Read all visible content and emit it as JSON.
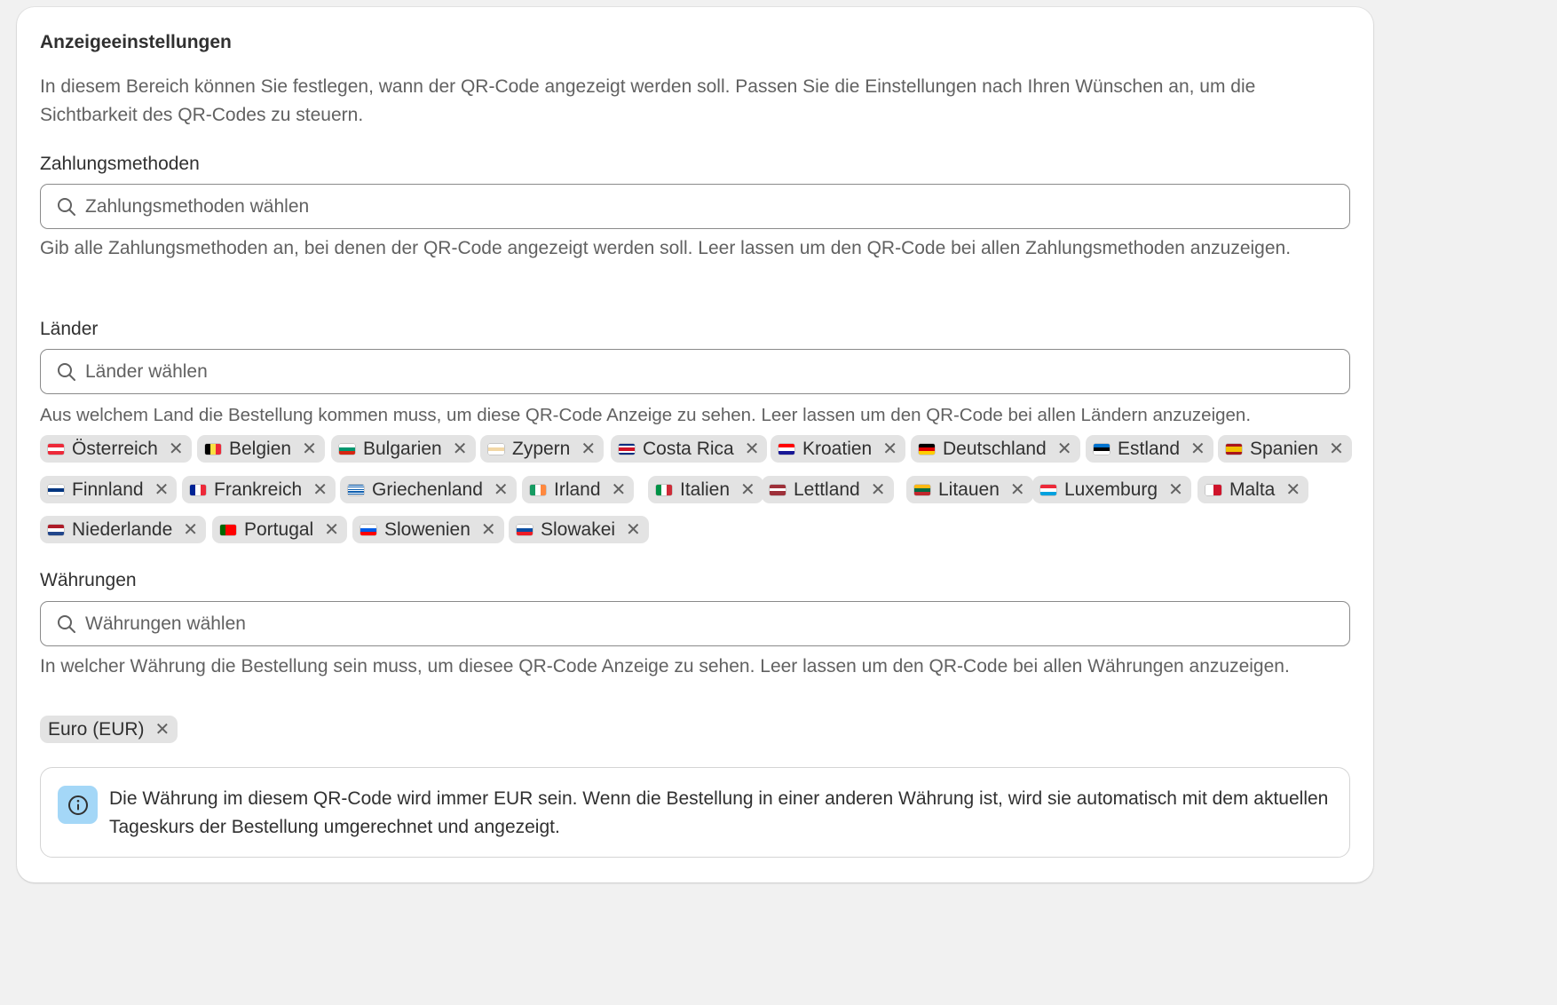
{
  "section": {
    "title": "Anzeigeeinstellungen",
    "description": "In diesem Bereich können Sie festlegen, wann der QR-Code angezeigt werden soll. Passen Sie die Einstellungen nach Ihren Wünschen an, um die Sichtbarkeit des QR-Codes zu steuern."
  },
  "payment": {
    "label": "Zahlungsmethoden",
    "placeholder": "Zahlungsmethoden wählen",
    "help": "Gib alle Zahlungsmethoden an, bei denen der QR-Code angezeigt werden soll. Leer lassen um den QR-Code bei allen Zahlungsmethoden anzuzeigen."
  },
  "countries": {
    "label": "Länder",
    "placeholder": "Länder wählen",
    "help": "Aus welchem Land die Bestellung kommen muss, um diese QR-Code Anzeige zu sehen. Leer lassen um den QR-Code bei allen Ländern anzuzeigen.",
    "tags": [
      {
        "label": "Österreich",
        "flag": "at"
      },
      {
        "label": "Belgien",
        "flag": "be"
      },
      {
        "label": "Bulgarien",
        "flag": "bg"
      },
      {
        "label": "Zypern",
        "flag": "cy"
      },
      {
        "label": "Costa Rica",
        "flag": "cr"
      },
      {
        "label": "Kroatien",
        "flag": "hr"
      },
      {
        "label": "Deutschland",
        "flag": "de"
      },
      {
        "label": "Estland",
        "flag": "ee"
      },
      {
        "label": "Spanien",
        "flag": "es"
      },
      {
        "label": "Finnland",
        "flag": "fi"
      },
      {
        "label": "Frankreich",
        "flag": "fr"
      },
      {
        "label": "Griechenland",
        "flag": "gr"
      },
      {
        "label": "Irland",
        "flag": "ie"
      },
      {
        "label": "Italien",
        "flag": "it"
      },
      {
        "label": "Lettland",
        "flag": "lv"
      },
      {
        "label": "Litauen",
        "flag": "lt"
      },
      {
        "label": "Luxemburg",
        "flag": "lu"
      },
      {
        "label": "Malta",
        "flag": "mt"
      },
      {
        "label": "Niederlande",
        "flag": "nl"
      },
      {
        "label": "Portugal",
        "flag": "pt"
      },
      {
        "label": "Slowenien",
        "flag": "si"
      },
      {
        "label": "Slowakei",
        "flag": "sk"
      }
    ]
  },
  "currencies": {
    "label": "Währungen",
    "placeholder": "Währungen wählen",
    "help": "In welcher Währung die Bestellung sein muss, um diesee QR-Code Anzeige zu sehen. Leer lassen um den QR-Code bei allen Währungen anzuzeigen.",
    "tags": [
      {
        "label": "Euro (EUR)"
      }
    ]
  },
  "banner": {
    "text": "Die Währung im diesem QR-Code wird immer EUR sein. Wenn die Bestellung in einer anderen Währung ist, wird sie automatisch mit dem aktuellen Tageskurs der Bestellung umgerechnet und angezeigt.",
    "icon": "info-icon"
  },
  "icons": {
    "search": "search-icon",
    "remove": "close-icon",
    "remove_glyph": "✕"
  },
  "colors": {
    "tag_bg": "#e3e3e3",
    "banner_icon_bg": "#a4d7f7",
    "field_border": "#8a8a8a"
  }
}
